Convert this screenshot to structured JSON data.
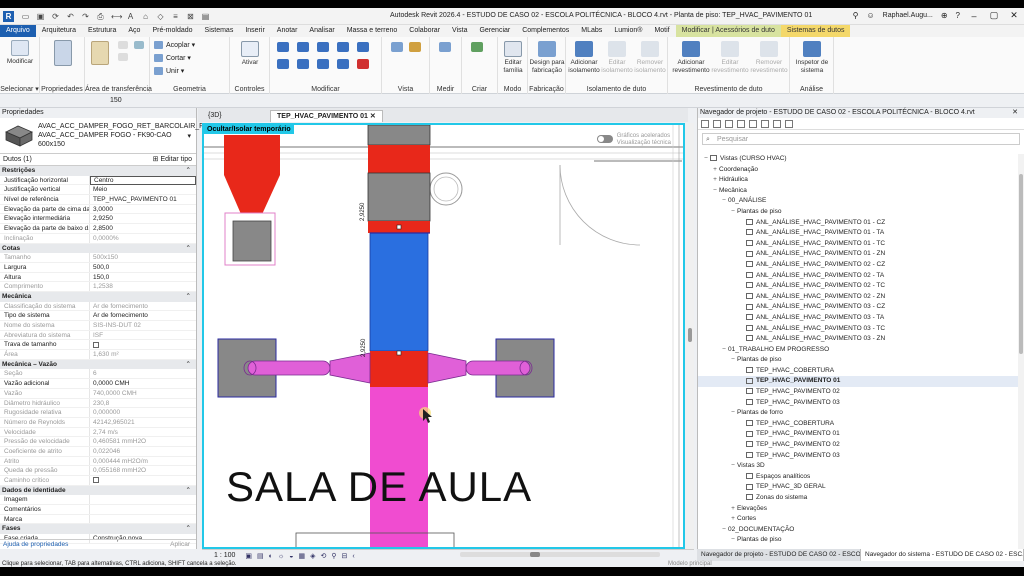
{
  "app": {
    "title": "Autodesk Revit 2026.4 - ESTUDO DE CASO 02 - ESCOLA POLITÉCNICA - BLOCO 4.rvt - Planta de piso: TEP_HVAC_PAVIMENTO 01",
    "logo": "R",
    "user": "Raphael.Augu...",
    "accent": "#1d5fb0"
  },
  "tabs": [
    "Arquivo",
    "Arquitetura",
    "Estrutura",
    "Aço",
    "Pré-moldado",
    "Sistemas",
    "Inserir",
    "Anotar",
    "Analisar",
    "Massa e terreno",
    "Colaborar",
    "Vista",
    "Gerenciar",
    "Complementos",
    "MLabs",
    "Lumion®",
    "Motif",
    "Modificar | Acessórios de duto",
    "Sistemas de dutos"
  ],
  "ribbon": {
    "modify": "Modificar",
    "select_label": "Selecionar ▾",
    "props_label": "Propriedades",
    "clipboard_label": "Área de transferência",
    "geometry_label": "Geometria",
    "copy": "Acoplar ▾",
    "cut": "Cortar ▾",
    "join": "Unir ▾",
    "controls_label": "Controles",
    "activate": "Ativar",
    "modify_label": "Modificar",
    "view_label": "Vista",
    "measure_label": "Medir",
    "create_label": "Criar",
    "mode_label": "Modo",
    "edit_family": "Editar família",
    "design_fab": "Design para fabricação",
    "fab_label": "Fabricação",
    "add_insulation": "Adicionar isolamento",
    "edit_insulation": "Editar isolamento",
    "remove_insulation": "Remover isolamento",
    "insulation_label": "Isolamento de duto",
    "add_lining": "Adicionar revestimento",
    "edit_lining": "Editar revestimento",
    "remove_lining": "Remover revestimento",
    "lining_label": "Revestimento de duto",
    "inspector": "Inspetor de sistema",
    "analysis_label": "Análise"
  },
  "options_bar": {
    "value": "150"
  },
  "properties": {
    "title": "Propriedades",
    "type_name": "AVAC_ACC_DAMPER_FOGO_RET_BARCOLAIR_FK90_CAO",
    "type_sub": "AVAC_ACC_DAMPER FOGO - FK90-CAO 600x150",
    "instance": "Dutos (1)",
    "edit_type": "Editar tipo",
    "help": "Ajuda de propriedades",
    "apply": "Aplicar",
    "groups": [
      {
        "name": "Restrições",
        "rows": [
          {
            "k": "Justificação horizontal",
            "v": "Centro",
            "input": true
          },
          {
            "k": "Justificação vertical",
            "v": "Meio"
          },
          {
            "k": "Nível de referência",
            "v": "TEP_HVAC_PAVIMENTO 01"
          },
          {
            "k": "Elevação da parte de cima da...",
            "v": "3,0000"
          },
          {
            "k": "Elevação intermediária",
            "v": "2,9250"
          },
          {
            "k": "Elevação da parte de baixo d...",
            "v": "2,8500"
          },
          {
            "k": "Inclinação",
            "v": "0,0000%",
            "grey": true
          }
        ]
      },
      {
        "name": "Cotas",
        "rows": [
          {
            "k": "Tamanho",
            "v": "500x150",
            "grey": true
          },
          {
            "k": "Largura",
            "v": "500,0"
          },
          {
            "k": "Altura",
            "v": "150,0"
          },
          {
            "k": "Comprimento",
            "v": "1,2538",
            "grey": true
          }
        ]
      },
      {
        "name": "Mecânica",
        "rows": [
          {
            "k": "Classificação do sistema",
            "v": "Ar de fornecimento",
            "grey": true
          },
          {
            "k": "Tipo de sistema",
            "v": "Ar de fornecimento"
          },
          {
            "k": "Nome do sistema",
            "v": "SIS-INS-DUT 02",
            "grey": true
          },
          {
            "k": "Abreviatura do sistema",
            "v": "ISF",
            "grey": true
          },
          {
            "k": "Trava de tamanho",
            "v": "",
            "check": true
          },
          {
            "k": "Área",
            "v": "1,630 m²",
            "grey": true
          }
        ]
      },
      {
        "name": "Mecânica – Vazão",
        "rows": [
          {
            "k": "Seção",
            "v": "6",
            "grey": true
          },
          {
            "k": "Vazão adicional",
            "v": "0,0000 CMH"
          },
          {
            "k": "Vazão",
            "v": "740,0000 CMH",
            "grey": true
          },
          {
            "k": "Diâmetro hidráulico",
            "v": "230,8",
            "grey": true
          },
          {
            "k": "Rugosidade relativa",
            "v": "0,000000",
            "grey": true
          },
          {
            "k": "Número de Reynolds",
            "v": "42142,965021",
            "grey": true
          },
          {
            "k": "Velocidade",
            "v": "2,74 m/s",
            "grey": true
          },
          {
            "k": "Pressão de velocidade",
            "v": "0,460581 mmH2O",
            "grey": true
          },
          {
            "k": "Coeficiente de atrito",
            "v": "0,022046",
            "grey": true
          },
          {
            "k": "Atrito",
            "v": "0,000444 mH2O/m",
            "grey": true
          },
          {
            "k": "Queda de pressão",
            "v": "0,055168 mmH2O",
            "grey": true
          },
          {
            "k": "Caminho crítico",
            "v": "",
            "grey": true,
            "check": true
          }
        ]
      },
      {
        "name": "Dados de identidade",
        "rows": [
          {
            "k": "Imagem",
            "v": ""
          },
          {
            "k": "Comentários",
            "v": ""
          },
          {
            "k": "Marca",
            "v": ""
          }
        ]
      },
      {
        "name": "Fases",
        "rows": [
          {
            "k": "Fase criada",
            "v": "Construção nova"
          }
        ]
      }
    ]
  },
  "view": {
    "tabs": [
      "{3D}",
      "TEP_HVAC_PAVIMENTO 01"
    ],
    "temp_hide": "Ocultar/Isolar temporário",
    "gfx1": "Gráficos acelerados",
    "gfx2": "Visualização técnica",
    "room": "SALA DE AULA",
    "elev1": "2,9250",
    "elev2": "2,9250",
    "scale": "1 : 100",
    "colors": {
      "supply": "#2a6fe0",
      "fire": "#e8281a",
      "flex": "#e060d8",
      "branch": "#f04cd0",
      "box": "#888888",
      "outline": "#2a2aa0"
    }
  },
  "browser": {
    "title": "Navegador de projeto - ESTUDO DE CASO 02 - ESCOLA POLITÉCNICA - BLOCO 4.rvt",
    "search": "Pesquisar",
    "items": [
      {
        "t": "Vistas (CURSO HVAC)",
        "l": 0,
        "tg": "−",
        "v": true
      },
      {
        "t": "Coordenação",
        "l": 1,
        "tg": "+"
      },
      {
        "t": "Hidráulica",
        "l": 1,
        "tg": "+"
      },
      {
        "t": "Mecânica",
        "l": 1,
        "tg": "−"
      },
      {
        "t": "00_ANÁLISE",
        "l": 2,
        "tg": "−"
      },
      {
        "t": "Plantas de piso",
        "l": 3,
        "tg": "−"
      },
      {
        "t": "ANL_ANÁLISE_HVAC_PAVIMENTO 01 - CZ",
        "l": 4,
        "v": true
      },
      {
        "t": "ANL_ANÁLISE_HVAC_PAVIMENTO 01 - TA",
        "l": 4,
        "v": true
      },
      {
        "t": "ANL_ANÁLISE_HVAC_PAVIMENTO 01 - TC",
        "l": 4,
        "v": true
      },
      {
        "t": "ANL_ANÁLISE_HVAC_PAVIMENTO 01 - ZN",
        "l": 4,
        "v": true
      },
      {
        "t": "ANL_ANÁLISE_HVAC_PAVIMENTO 02 - CZ",
        "l": 4,
        "v": true
      },
      {
        "t": "ANL_ANÁLISE_HVAC_PAVIMENTO 02 - TA",
        "l": 4,
        "v": true
      },
      {
        "t": "ANL_ANÁLISE_HVAC_PAVIMENTO 02 - TC",
        "l": 4,
        "v": true
      },
      {
        "t": "ANL_ANÁLISE_HVAC_PAVIMENTO 02 - ZN",
        "l": 4,
        "v": true
      },
      {
        "t": "ANL_ANÁLISE_HVAC_PAVIMENTO 03 - CZ",
        "l": 4,
        "v": true
      },
      {
        "t": "ANL_ANÁLISE_HVAC_PAVIMENTO 03 - TA",
        "l": 4,
        "v": true
      },
      {
        "t": "ANL_ANÁLISE_HVAC_PAVIMENTO 03 - TC",
        "l": 4,
        "v": true
      },
      {
        "t": "ANL_ANÁLISE_HVAC_PAVIMENTO 03 - ZN",
        "l": 4,
        "v": true
      },
      {
        "t": "01_TRABALHO EM PROGRESSO",
        "l": 2,
        "tg": "−"
      },
      {
        "t": "Plantas de piso",
        "l": 3,
        "tg": "−"
      },
      {
        "t": "TEP_HVAC_COBERTURA",
        "l": 4,
        "v": true
      },
      {
        "t": "TEP_HVAC_PAVIMENTO 01",
        "l": 4,
        "v": true,
        "sel": true
      },
      {
        "t": "TEP_HVAC_PAVIMENTO 02",
        "l": 4,
        "v": true
      },
      {
        "t": "TEP_HVAC_PAVIMENTO 03",
        "l": 4,
        "v": true
      },
      {
        "t": "Plantas de forro",
        "l": 3,
        "tg": "−"
      },
      {
        "t": "TEP_HVAC_COBERTURA",
        "l": 4,
        "v": true
      },
      {
        "t": "TEP_HVAC_PAVIMENTO 01",
        "l": 4,
        "v": true
      },
      {
        "t": "TEP_HVAC_PAVIMENTO 02",
        "l": 4,
        "v": true
      },
      {
        "t": "TEP_HVAC_PAVIMENTO 03",
        "l": 4,
        "v": true
      },
      {
        "t": "Vistas 3D",
        "l": 3,
        "tg": "−"
      },
      {
        "t": "Espaços analíticos",
        "l": 4,
        "v": true
      },
      {
        "t": "TEP_HVAC_3D GERAL",
        "l": 4,
        "v": true
      },
      {
        "t": "Zonas do sistema",
        "l": 4,
        "v": true
      },
      {
        "t": "Elevações",
        "l": 3,
        "tg": "+"
      },
      {
        "t": "Cortes",
        "l": 3,
        "tg": "+"
      },
      {
        "t": "02_DOCUMENTAÇÃO",
        "l": 2,
        "tg": "−"
      },
      {
        "t": "Plantas de piso",
        "l": 3,
        "tg": "−"
      }
    ],
    "bottom_tabs": [
      "Navegador de projeto - ESTUDO DE CASO 02 - ESCOL...",
      "Navegador do sistema - ESTUDO DE CASO 02 - ESC..."
    ]
  },
  "status": {
    "text": "Clique para selecionar, TAB para alternativas, CTRL adiciona, SHIFT cancela a seleção.",
    "model": "Modelo principal"
  }
}
